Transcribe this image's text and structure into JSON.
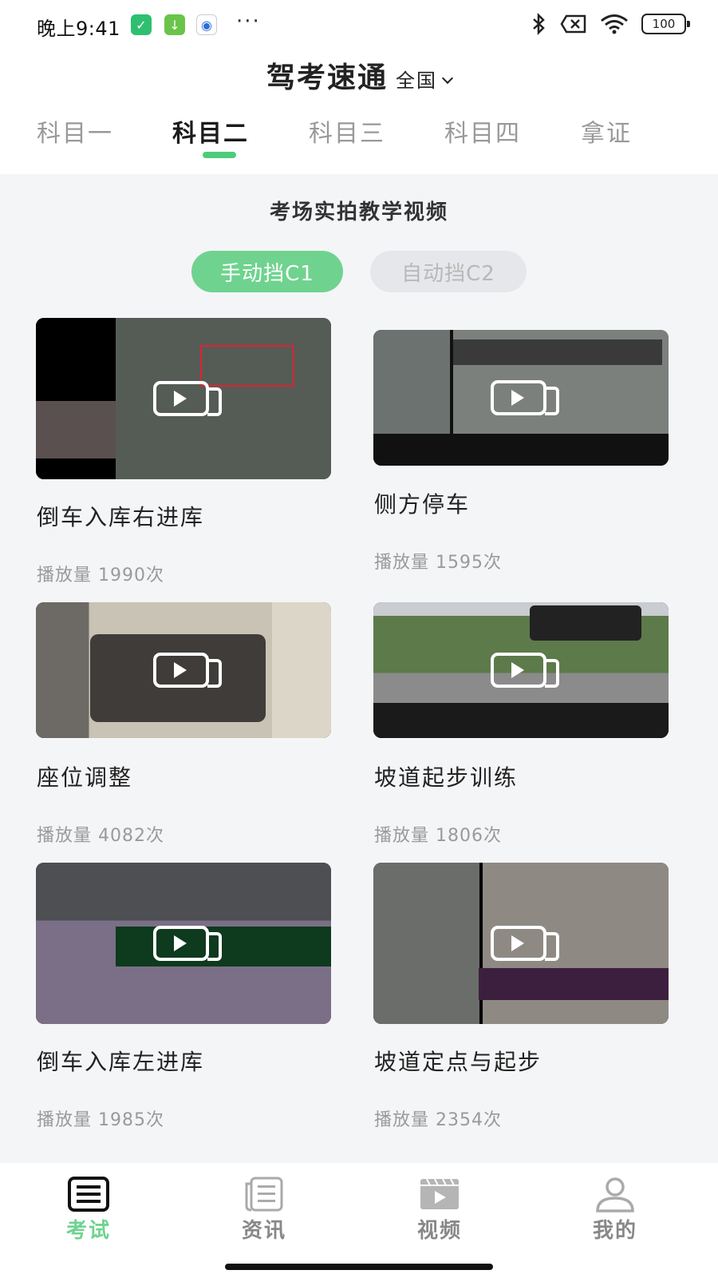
{
  "status_bar": {
    "time": "晚上9:41",
    "battery": "100"
  },
  "header": {
    "app_title": "驾考速通",
    "region": "全国"
  },
  "tabs": [
    {
      "label": "科目一"
    },
    {
      "label": "科目二"
    },
    {
      "label": "科目三"
    },
    {
      "label": "科目四"
    },
    {
      "label": "拿证"
    }
  ],
  "active_tab": "科目二",
  "section": {
    "title": "考场实拍教学视频"
  },
  "license_toggle": {
    "manual": "手动挡C1",
    "auto": "自动挡C2",
    "selected": "手动挡C1"
  },
  "videos": [
    {
      "title": "倒车入库右进库",
      "plays": "播放量 1990次"
    },
    {
      "title": "侧方停车",
      "plays": "播放量 1595次"
    },
    {
      "title": "座位调整",
      "plays": "播放量 4082次"
    },
    {
      "title": "坡道起步训练",
      "plays": "播放量 1806次"
    },
    {
      "title": "倒车入库左进库",
      "plays": "播放量 1985次"
    },
    {
      "title": "坡道定点与起步",
      "plays": "播放量 2354次"
    }
  ],
  "bottom_nav": [
    {
      "label": "考试",
      "icon": "exam-icon"
    },
    {
      "label": "资讯",
      "icon": "news-icon"
    },
    {
      "label": "视频",
      "icon": "video-icon"
    },
    {
      "label": "我的",
      "icon": "profile-icon"
    }
  ],
  "colors": {
    "accent": "#4dcb7b",
    "pill_active": "#6fd38f",
    "inactive_text": "#999999"
  }
}
